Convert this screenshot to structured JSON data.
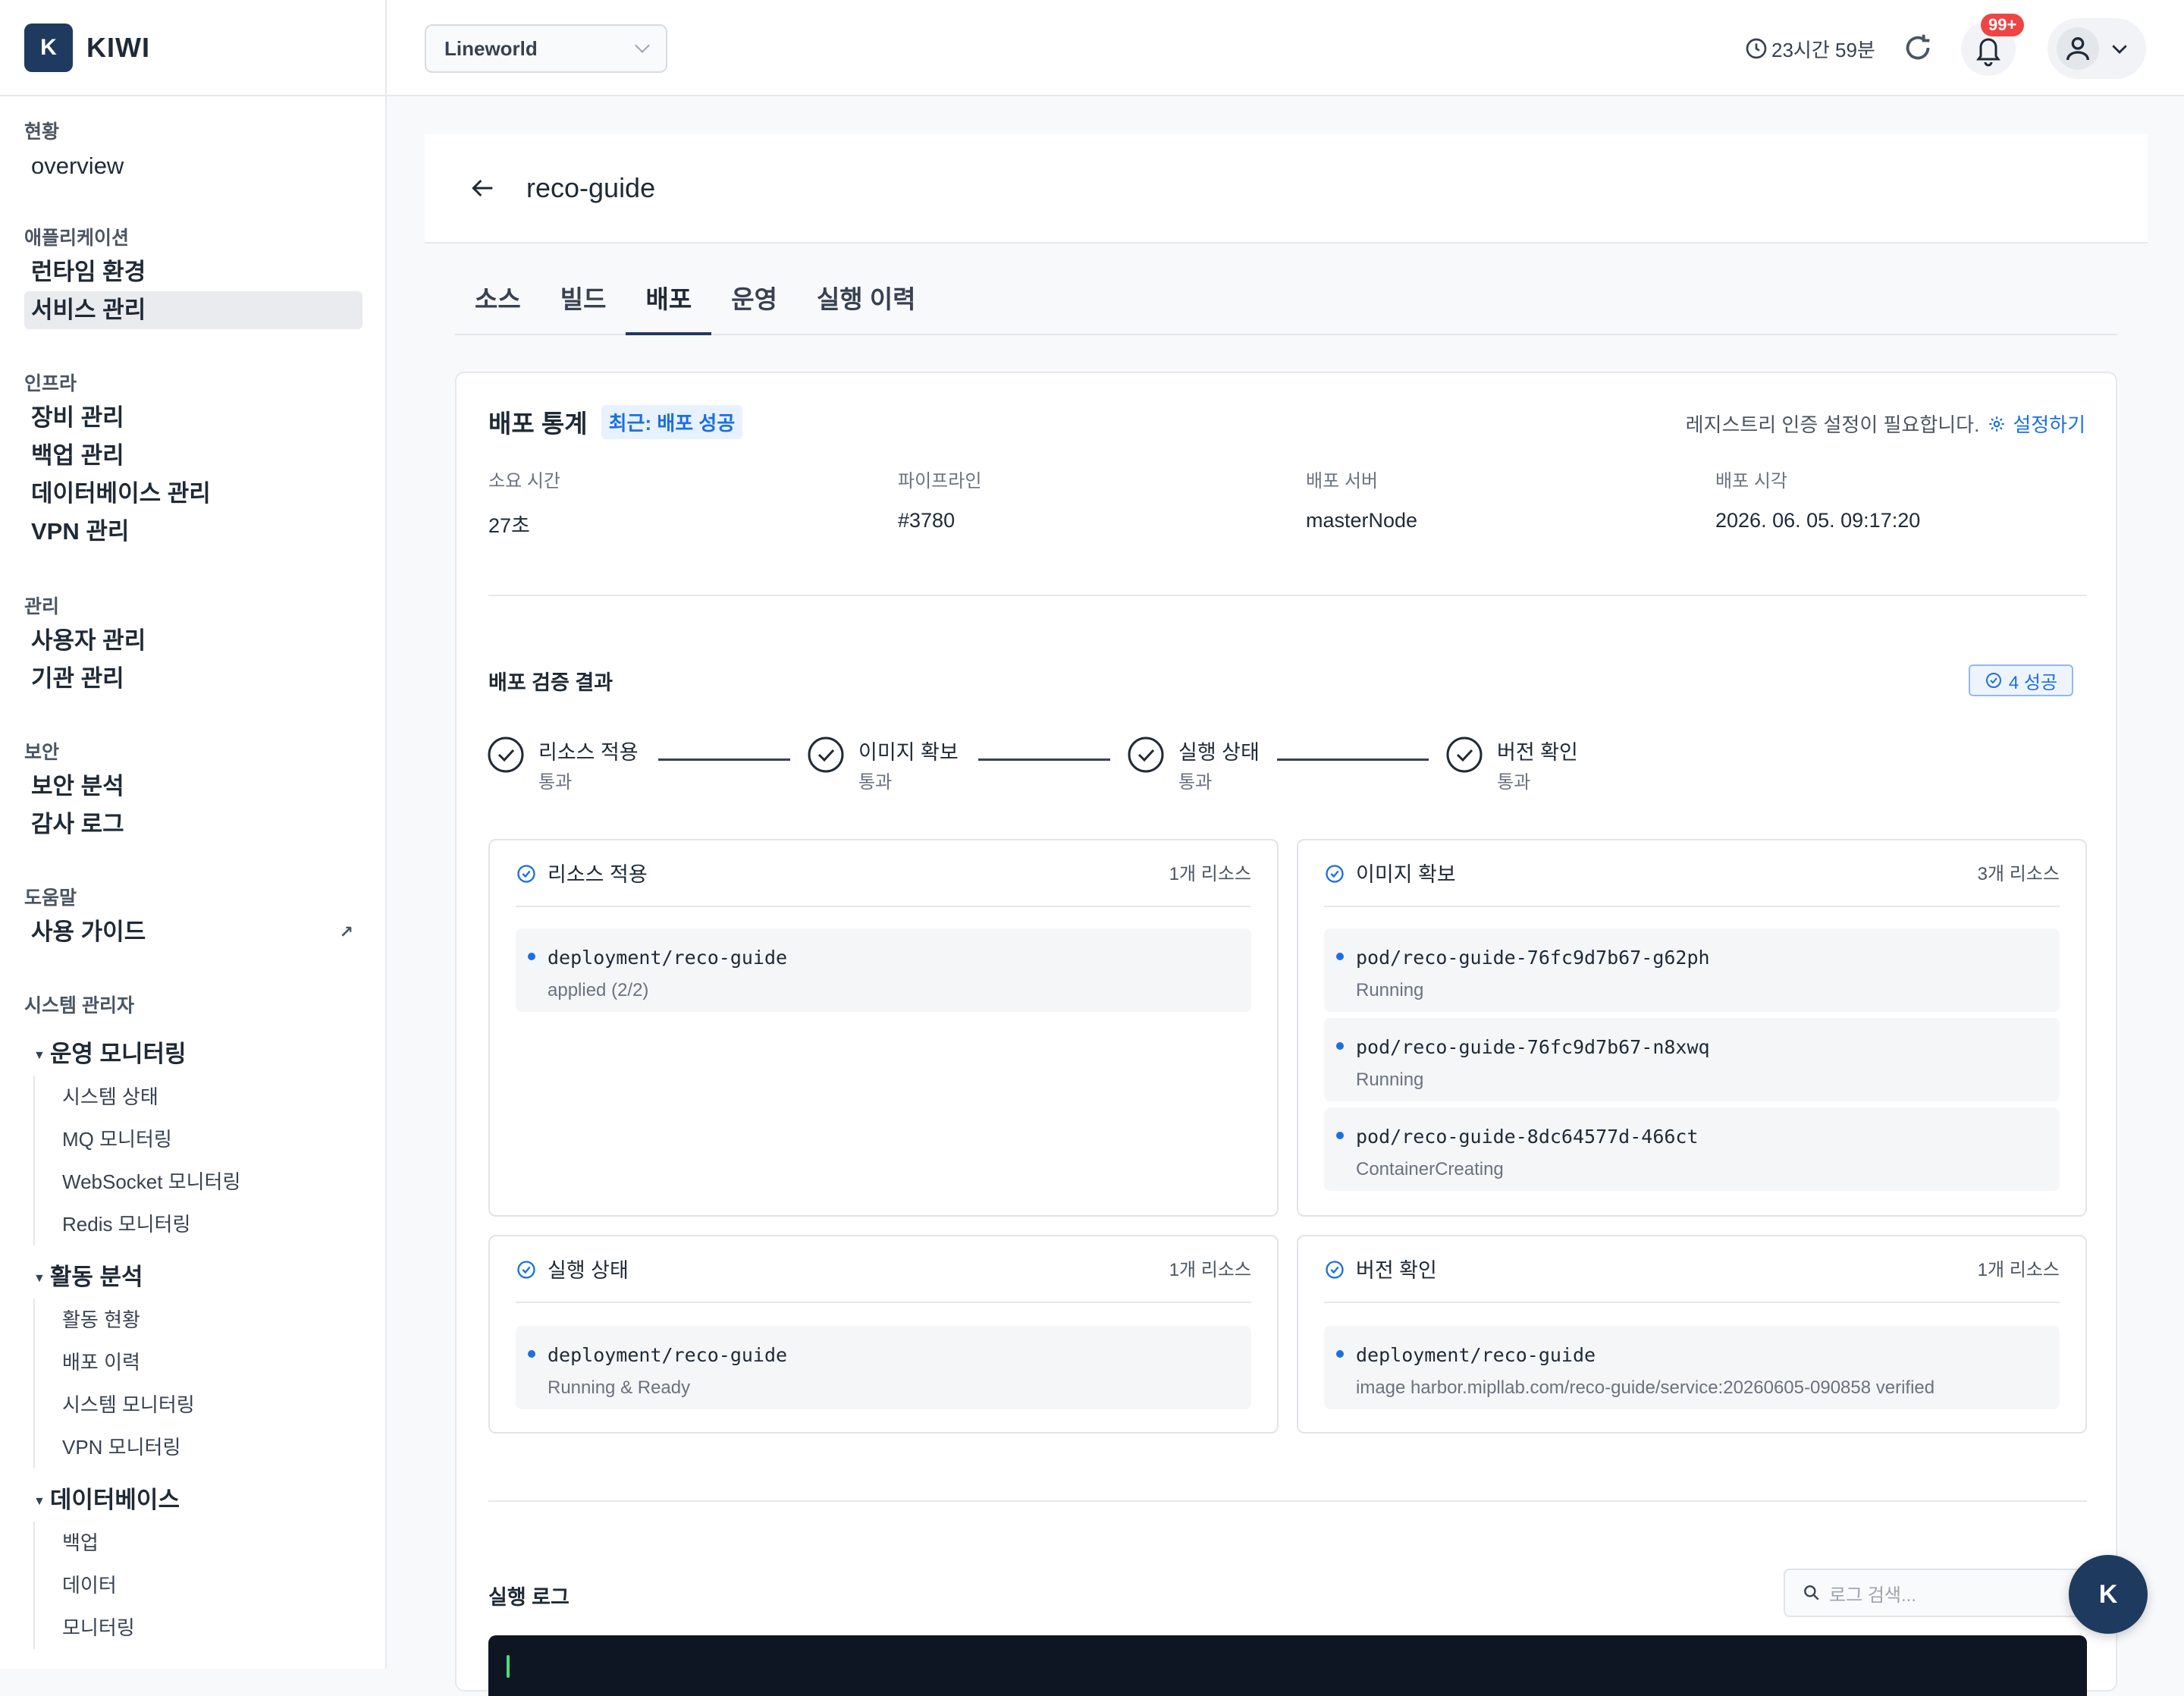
{
  "app": {
    "logo_letter": "K",
    "name": "KIWI"
  },
  "sidebar": {
    "sections": [
      {
        "label": "현황",
        "items": [
          "overview"
        ]
      },
      {
        "label": "애플리케이션",
        "items": [
          "런타임 환경",
          "서비스 관리"
        ],
        "active": "서비스 관리"
      },
      {
        "label": "인프라",
        "items": [
          "장비 관리",
          "백업 관리",
          "데이터베이스 관리",
          "VPN 관리"
        ]
      },
      {
        "label": "관리",
        "items": [
          "사용자 관리",
          "기관 관리"
        ]
      },
      {
        "label": "보안",
        "items": [
          "보안 분석",
          "감사 로그"
        ]
      },
      {
        "label": "도움말",
        "items": [
          "사용 가이드"
        ],
        "external_icon": "↗"
      }
    ],
    "admin": {
      "label": "시스템 관리자",
      "groups": [
        {
          "title": "운영 모니터링",
          "items": [
            "시스템 상태",
            "MQ 모니터링",
            "WebSocket 모니터링",
            "Redis 모니터링"
          ]
        },
        {
          "title": "활동 분석",
          "items": [
            "활동 현황",
            "배포 이력",
            "시스템 모니터링",
            "VPN 모니터링"
          ]
        },
        {
          "title": "데이터베이스",
          "items": [
            "백업",
            "데이터",
            "모니터링"
          ]
        }
      ]
    }
  },
  "topbar": {
    "workspace": "Lineworld",
    "session_time": "23시간 59분",
    "notification_count": "99+",
    "icons": [
      "clock-icon",
      "refresh-icon",
      "bell-icon",
      "user-icon",
      "chevron-down-icon"
    ]
  },
  "page": {
    "title": "reco-guide",
    "tabs": [
      "소스",
      "빌드",
      "배포",
      "운영",
      "실행 이력"
    ],
    "active_tab": "배포"
  },
  "deploy_stats": {
    "title": "배포 통계",
    "badge": "최근: 배포 성공",
    "registry_notice": "레지스트리 인증 설정이 필요합니다.",
    "registry_link": "설정하기",
    "items": [
      {
        "label": "소요 시간",
        "value": "27초"
      },
      {
        "label": "파이프라인",
        "value": "#3780"
      },
      {
        "label": "배포 서버",
        "value": "masterNode"
      },
      {
        "label": "배포 시각",
        "value": "2026. 06. 05. 09:17:20"
      }
    ]
  },
  "verification": {
    "title": "배포 검증 결과",
    "summary": "4 성공",
    "steps": [
      {
        "name": "리소스 적용",
        "status": "통과"
      },
      {
        "name": "이미지 확보",
        "status": "통과"
      },
      {
        "name": "실행 상태",
        "status": "통과"
      },
      {
        "name": "버전 확인",
        "status": "통과"
      }
    ],
    "cards": [
      {
        "title": "리소스 적용",
        "count": "1개 리소스",
        "resources": [
          {
            "name": "deployment/reco-guide",
            "status": "applied (2/2)"
          }
        ]
      },
      {
        "title": "이미지 확보",
        "count": "3개 리소스",
        "resources": [
          {
            "name": "pod/reco-guide-76fc9d7b67-g62ph",
            "status": "Running"
          },
          {
            "name": "pod/reco-guide-76fc9d7b67-n8xwq",
            "status": "Running"
          },
          {
            "name": "pod/reco-guide-8dc64577d-466ct",
            "status": "ContainerCreating"
          }
        ]
      },
      {
        "title": "실행 상태",
        "count": "1개 리소스",
        "resources": [
          {
            "name": "deployment/reco-guide",
            "status": "Running & Ready"
          }
        ]
      },
      {
        "title": "버전 확인",
        "count": "1개 리소스",
        "resources": [
          {
            "name": "deployment/reco-guide",
            "status": "image harbor.mipllab.com/reco-guide/service:20260605-090858 verified"
          }
        ]
      }
    ]
  },
  "log": {
    "title": "실행 로그",
    "search_placeholder": "로그 검색..."
  },
  "fab_label": "K",
  "colors": {
    "brand": "#1f3a5f",
    "accent": "#1d6fe0",
    "badge": "#ef4444",
    "log_bg": "#0f1623"
  }
}
